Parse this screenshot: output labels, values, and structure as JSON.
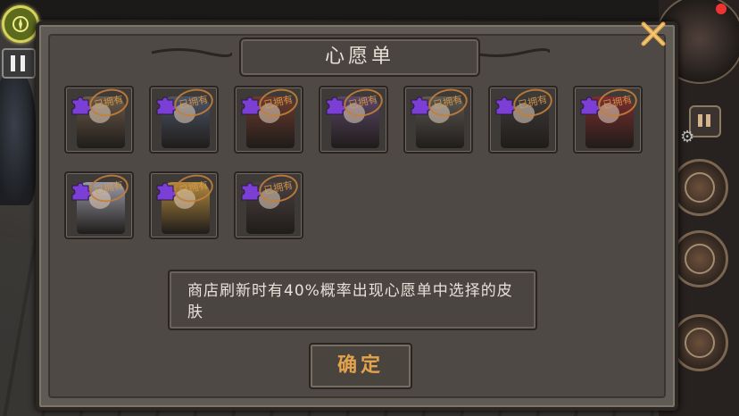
{
  "dialog": {
    "title": "心愿单",
    "info_text": "商店刷新时有40%概率出现心愿单中选择的皮肤",
    "confirm_label": "确定"
  },
  "skins": [
    {
      "owned_label": "已拥有",
      "color": "#6a5a4a"
    },
    {
      "owned_label": "已拥有",
      "color": "#4e5566"
    },
    {
      "owned_label": "已拥有",
      "color": "#6b3c2e"
    },
    {
      "owned_label": "已拥有",
      "color": "#5a4766"
    },
    {
      "owned_label": "已拥有",
      "color": "#5c5852"
    },
    {
      "owned_label": "已拥有",
      "color": "#3e3a3a"
    },
    {
      "owned_label": "已拥有",
      "color": "#7a2e2e"
    },
    {
      "owned_label": "已拥有",
      "color": "#9a9aa6"
    },
    {
      "owned_label": "已拥有",
      "color": "#b38a3e"
    },
    {
      "owned_label": "已拥有",
      "color": "#4a4040"
    }
  ],
  "colors": {
    "panel_bg": "#5f5a54",
    "confirm_text": "#e4a24b",
    "puzzle_icon": "#7b3fd6",
    "close_icon": "#e0a54a"
  },
  "icons": {
    "close": "close-icon",
    "puzzle": "puzzle-piece-icon",
    "pause": "pause-icon",
    "settings": "gear-icon"
  }
}
